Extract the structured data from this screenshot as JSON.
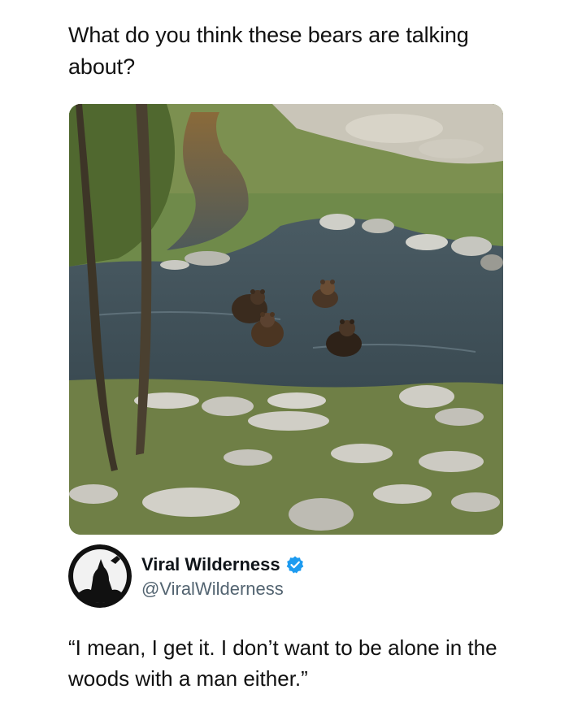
{
  "post": {
    "question": "What do you think these bears are talking about?"
  },
  "photo": {
    "subject": "four brown bears swimming in a forest creek",
    "icon": "photo"
  },
  "tweet": {
    "author": {
      "display_name": "Viral Wilderness",
      "handle": "@ViralWilderness",
      "verified": true,
      "avatar_icon": "howling-wolf-moon"
    },
    "text": "“I mean, I get it. I don’t want to be alone in the woods with a man either.”"
  },
  "colors": {
    "text": "#0f1419",
    "handle": "#536471",
    "verified_badge": "#1d9bf0",
    "background": "#ffffff"
  }
}
